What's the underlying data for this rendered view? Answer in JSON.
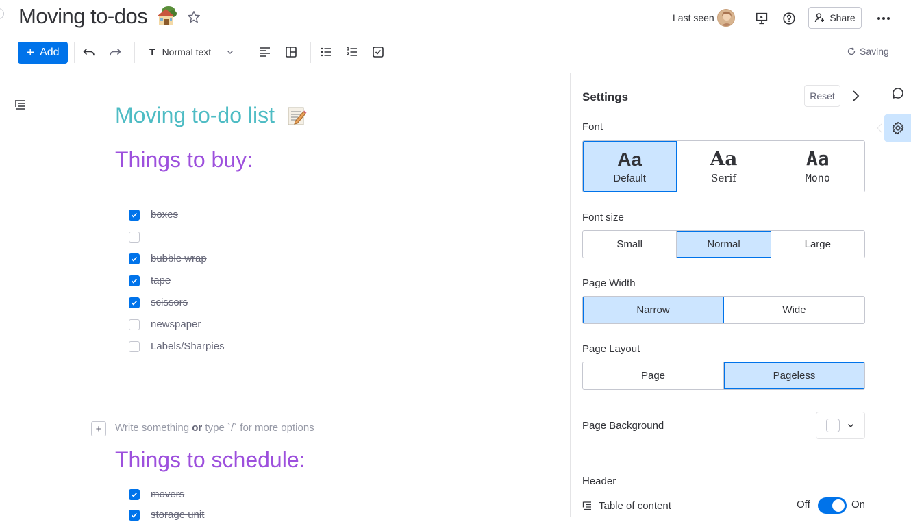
{
  "header": {
    "title": "Moving to-dos",
    "last_seen": "Last seen",
    "share_label": "Share"
  },
  "toolbar": {
    "add_label": "Add",
    "text_style": "Normal text",
    "saving_label": "Saving"
  },
  "editor": {
    "heading": "Moving to-do list",
    "section1_title": "Things to buy:",
    "section1_items": [
      {
        "text": "boxes",
        "checked": true
      },
      {
        "text": "",
        "checked": false
      },
      {
        "text": "bubble wrap",
        "checked": true
      },
      {
        "text": "tape",
        "checked": true
      },
      {
        "text": "scissors",
        "checked": true
      },
      {
        "text": "newspaper",
        "checked": false
      },
      {
        "text": "Labels/Sharpies",
        "checked": false
      }
    ],
    "placeholder_a": "Write something ",
    "placeholder_or": "or",
    "placeholder_b": " type `/` for more options",
    "section2_title": "Things to schedule:",
    "section2_items": [
      {
        "text": "movers",
        "checked": true
      },
      {
        "text": "storage unit",
        "checked": true
      }
    ]
  },
  "settings": {
    "title": "Settings",
    "reset_label": "Reset",
    "font_label": "Font",
    "font_sample": "Aa",
    "font_options": [
      "Default",
      "Serif",
      "Mono"
    ],
    "font_selected": "Default",
    "font_size_label": "Font size",
    "font_size_options": [
      "Small",
      "Normal",
      "Large"
    ],
    "font_size_selected": "Normal",
    "page_width_label": "Page Width",
    "page_width_options": [
      "Narrow",
      "Wide"
    ],
    "page_width_selected": "Narrow",
    "page_layout_label": "Page Layout",
    "page_layout_options": [
      "Page",
      "Pageless"
    ],
    "page_layout_selected": "Pageless",
    "page_background_label": "Page Background",
    "header_label": "Header",
    "toc_label": "Table of content",
    "toggle_off": "Off",
    "toggle_on": "On"
  },
  "colors": {
    "accent": "#0073ea",
    "selected_bg": "#cce5ff",
    "heading_teal": "#4ebcc4",
    "heading_purple": "#9d50dd"
  },
  "icons": [
    "star-icon",
    "present-icon",
    "help-icon",
    "share-user-icon",
    "more-icon",
    "undo-icon",
    "redo-icon",
    "text-icon",
    "chevron-down-icon",
    "align-left-icon",
    "layout-icon",
    "bullet-list-icon",
    "numbered-list-icon",
    "checklist-icon",
    "refresh-icon",
    "outline-icon",
    "chevron-right-icon",
    "chat-icon",
    "gear-icon"
  ]
}
